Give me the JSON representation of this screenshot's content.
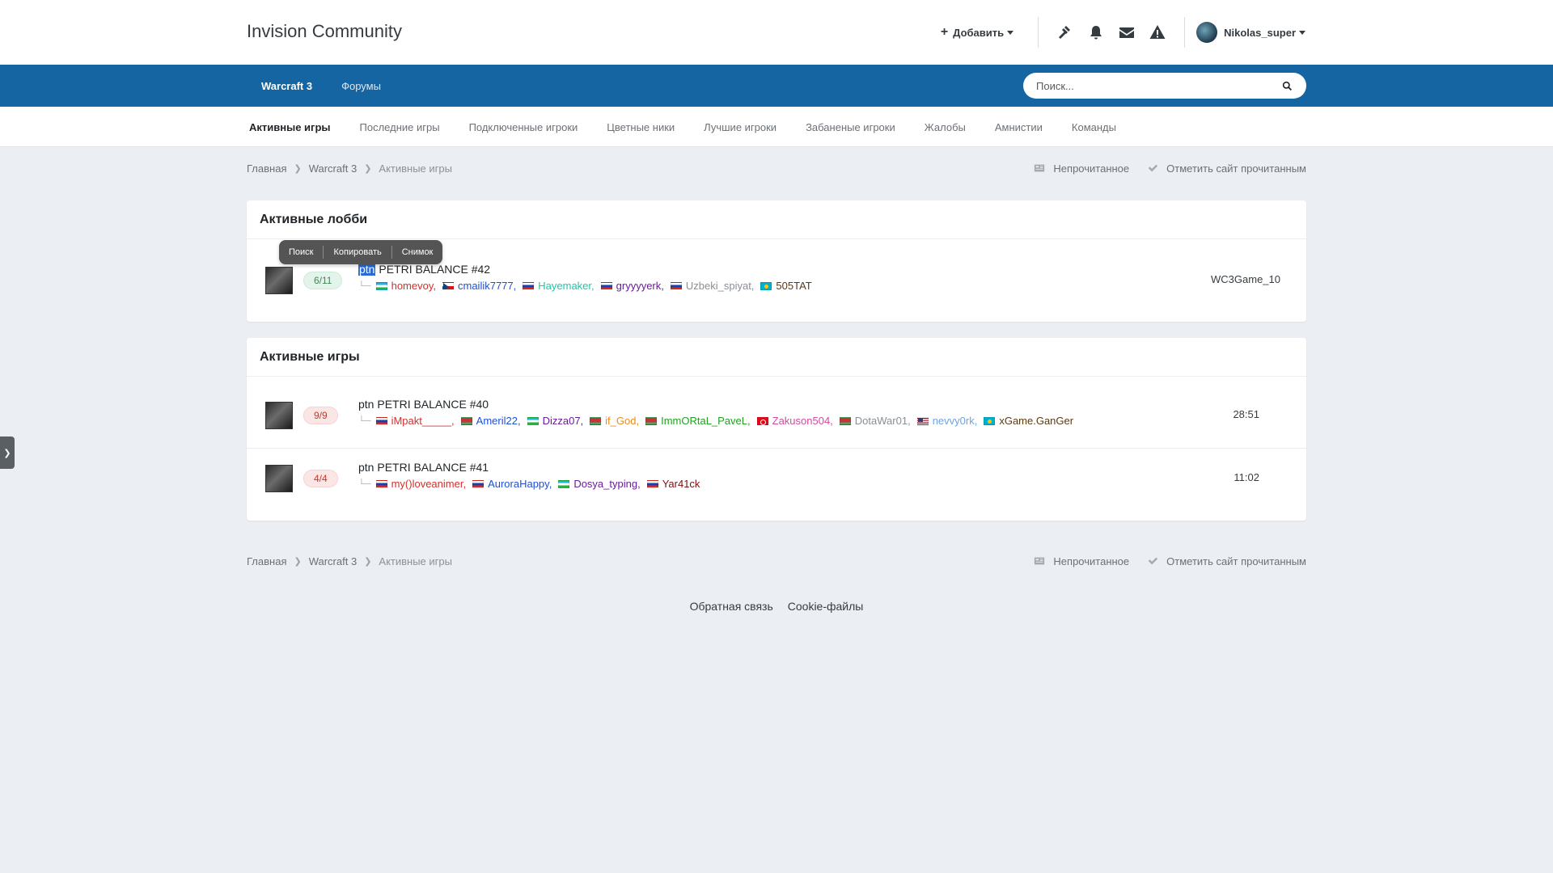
{
  "site": {
    "title": "Invision Community"
  },
  "user_nav": {
    "add_label": "Добавить",
    "username": "Nikolas_super",
    "icons": [
      "gavel-icon",
      "bell-icon",
      "envelope-icon",
      "warning-icon"
    ]
  },
  "primary_nav": {
    "items": [
      {
        "label": "Warcraft 3",
        "active": true
      },
      {
        "label": "Форумы",
        "active": false
      }
    ],
    "search_placeholder": "Поиск..."
  },
  "secondary_nav": {
    "items": [
      {
        "label": "Активные игры",
        "active": true
      },
      {
        "label": "Последние игры"
      },
      {
        "label": "Подключенные игроки"
      },
      {
        "label": "Цветные ники"
      },
      {
        "label": "Лучшие игроки"
      },
      {
        "label": "Забаненые игроки"
      },
      {
        "label": "Жалобы"
      },
      {
        "label": "Амнистии"
      },
      {
        "label": "Команды"
      }
    ]
  },
  "breadcrumb": {
    "items": [
      "Главная",
      "Warcraft 3",
      "Активные игры"
    ],
    "unread_label": "Непрочитанное",
    "mark_read_label": "Отметить сайт прочитанным"
  },
  "context_menu": {
    "items": [
      "Поиск",
      "Копировать",
      "Снимок"
    ]
  },
  "lobbies": {
    "title": "Активные лобби",
    "rows": [
      {
        "slots": "6/11",
        "name_prefix": "ptn",
        "name_rest": " PETRI BALANCE #42",
        "host": "WC3Game_10",
        "players": [
          {
            "flag": "uz",
            "name": "homevoy,",
            "color": "#d0312d"
          },
          {
            "flag": "cz",
            "name": "cmailik7777,",
            "color": "#1d4fd8"
          },
          {
            "flag": "ru",
            "name": "Hayemaker,",
            "color": "#1fc7a7"
          },
          {
            "flag": "ru",
            "name": "gryyyyerk,",
            "color": "#6a1b9a"
          },
          {
            "flag": "ru",
            "name": "Uzbeki_spiyat,",
            "color": "#8a8f94"
          },
          {
            "flag": "kz",
            "name": "505TAT",
            "color": "#5a3a10"
          }
        ]
      }
    ]
  },
  "games": {
    "title": "Активные игры",
    "rows": [
      {
        "slots": "9/9",
        "name": "ptn PETRI BALANCE #40",
        "time": "28:51",
        "players": [
          {
            "flag": "ru",
            "name": "iMpakt_____,",
            "color": "#d0312d"
          },
          {
            "flag": "by",
            "name": "Ameril22,",
            "color": "#1d4fd8"
          },
          {
            "flag": "uz",
            "name": "Dizza07,",
            "color": "#6a1b9a"
          },
          {
            "flag": "by",
            "name": "if_God,",
            "color": "#f08a1c"
          },
          {
            "flag": "by",
            "name": "ImmORtaL_PaveL,",
            "color": "#21a121"
          },
          {
            "flag": "tr",
            "name": "Zakuson504,",
            "color": "#d04ba0"
          },
          {
            "flag": "by",
            "name": "DotaWar01,",
            "color": "#8a8f94"
          },
          {
            "flag": "us",
            "name": "nevvy0rk,",
            "color": "#6fa3e0"
          },
          {
            "flag": "kz",
            "name": "xGame.GanGer",
            "color": "#5a3a10"
          }
        ]
      },
      {
        "slots": "4/4",
        "name": "ptn PETRI BALANCE #41",
        "time": "11:02",
        "players": [
          {
            "flag": "ru",
            "name": "my()loveanimer,",
            "color": "#d0312d"
          },
          {
            "flag": "ru",
            "name": "AuroraHappy,",
            "color": "#1d4fd8"
          },
          {
            "flag": "uz",
            "name": "Dosya_typing,",
            "color": "#6a1b9a"
          },
          {
            "flag": "ru",
            "name": "Yar41ck",
            "color": "#7a1010"
          }
        ]
      }
    ]
  },
  "footer": {
    "links": [
      "Обратная связь",
      "Cookie-файлы"
    ]
  }
}
